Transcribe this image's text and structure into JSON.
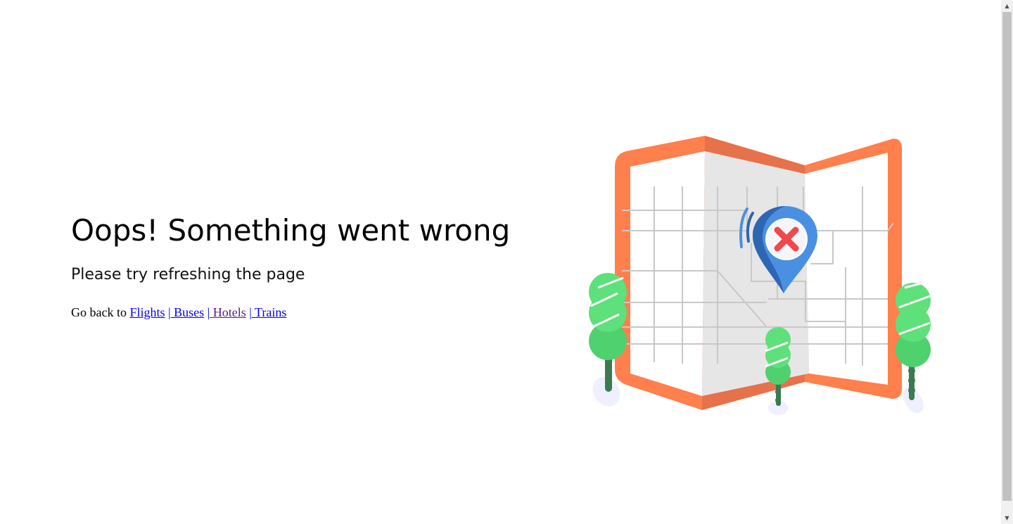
{
  "error": {
    "title": "Oops! Something went wrong",
    "subtitle": "Please try refreshing the page",
    "back_prefix": "Go back to",
    "links": [
      {
        "label": "Flights"
      },
      {
        "label": " Buses"
      },
      {
        "label": " Hotels"
      },
      {
        "label": " Trains"
      }
    ],
    "separator": "|"
  },
  "illustration": {
    "icon": "map-location-error-icon",
    "colors": {
      "frame": "#ff7f4d",
      "frame_shade": "#e6714a",
      "pin": "#4a90e2",
      "error_x": "#f0484e",
      "tree": "#4fd16f"
    }
  }
}
